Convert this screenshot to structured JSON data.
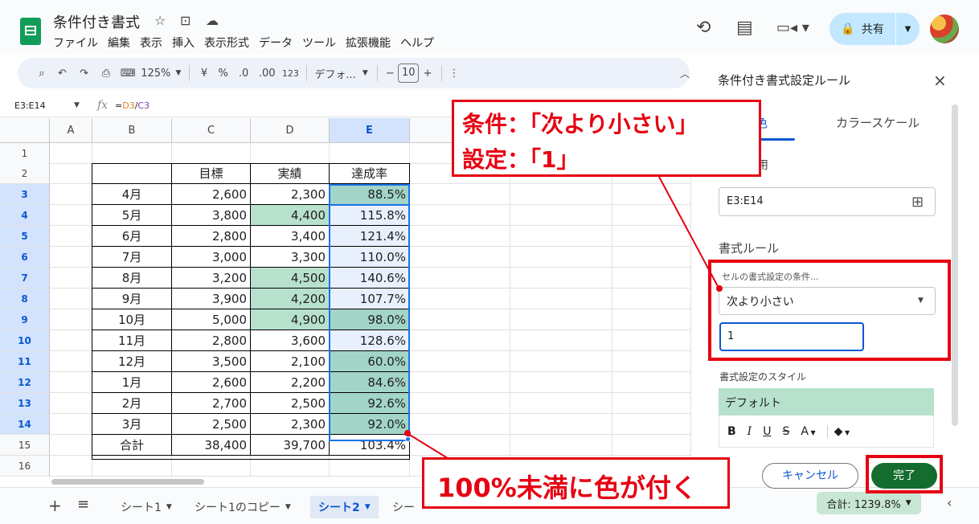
{
  "header": {
    "doc_title": "条件付き書式",
    "menu": [
      "ファイル",
      "編集",
      "表示",
      "挿入",
      "表示形式",
      "データ",
      "ツール",
      "拡張機能",
      "ヘルプ"
    ],
    "share_label": "共有"
  },
  "toolbar": {
    "zoom": "125%",
    "currency": "¥",
    "percent": "%",
    "decrease_decimal": ".0",
    "increase_decimal": ".00",
    "number_format": "123",
    "font": "デフォ...",
    "font_size": "10"
  },
  "formula_bar": {
    "name_box": "E3:E14",
    "formula_eq": "=",
    "formula_d3": "D3",
    "formula_slash": "/",
    "formula_c3": "C3"
  },
  "sheet": {
    "columns": [
      "A",
      "B",
      "C",
      "D",
      "E"
    ],
    "rows": [
      "1",
      "2",
      "3",
      "4",
      "5",
      "6",
      "7",
      "8",
      "9",
      "10",
      "11",
      "12",
      "13",
      "14",
      "15",
      "16"
    ],
    "headers": [
      "",
      "目標",
      "実績",
      "達成率"
    ],
    "data": [
      [
        "4月",
        "2,600",
        "2,300",
        "88.5%"
      ],
      [
        "5月",
        "3,800",
        "4,400",
        "115.8%"
      ],
      [
        "6月",
        "2,800",
        "3,400",
        "121.4%"
      ],
      [
        "7月",
        "3,000",
        "3,300",
        "110.0%"
      ],
      [
        "8月",
        "3,200",
        "4,500",
        "140.6%"
      ],
      [
        "9月",
        "3,900",
        "4,200",
        "107.7%"
      ],
      [
        "10月",
        "5,000",
        "4,900",
        "98.0%"
      ],
      [
        "11月",
        "2,800",
        "3,600",
        "128.6%"
      ],
      [
        "12月",
        "3,500",
        "2,100",
        "60.0%"
      ],
      [
        "1月",
        "2,600",
        "2,200",
        "84.6%"
      ],
      [
        "2月",
        "2,700",
        "2,500",
        "92.6%"
      ],
      [
        "3月",
        "2,500",
        "2,300",
        "92.0%"
      ]
    ],
    "total": [
      "合計",
      "38,400",
      "39,700",
      "103.4%"
    ]
  },
  "bottom_bar": {
    "tabs": [
      "シート1",
      "シート1のコピー",
      "シート2",
      "シー"
    ],
    "sum_chip": "合計: 1239.8%"
  },
  "panel": {
    "title": "条件付き書式設定ルール",
    "tab_single": "色",
    "tab_scale": "カラースケール",
    "apply_label": "用",
    "range": "E3:E14",
    "rule_label": "書式ルール",
    "condition_label": "セルの書式設定の条件...",
    "condition_value": "次より小さい",
    "value_input": "1",
    "style_label": "書式設定のスタイル",
    "style_preview": "デフォルト",
    "format_buttons": [
      "B",
      "I",
      "U",
      "S",
      "A"
    ],
    "cancel": "キャンセル",
    "done": "完了"
  },
  "annotations": {
    "top_line1": "条件：「次より小さい」",
    "top_line2": "設定：「1」",
    "bottom": "100%未満に色が付く"
  },
  "colors": {
    "highlight_green": "#b7e1cd",
    "highlight_teal": "#a2d4c8",
    "annotation_red": "#e60012",
    "done_green": "#146c2e",
    "share_blue": "#c2e7ff"
  }
}
